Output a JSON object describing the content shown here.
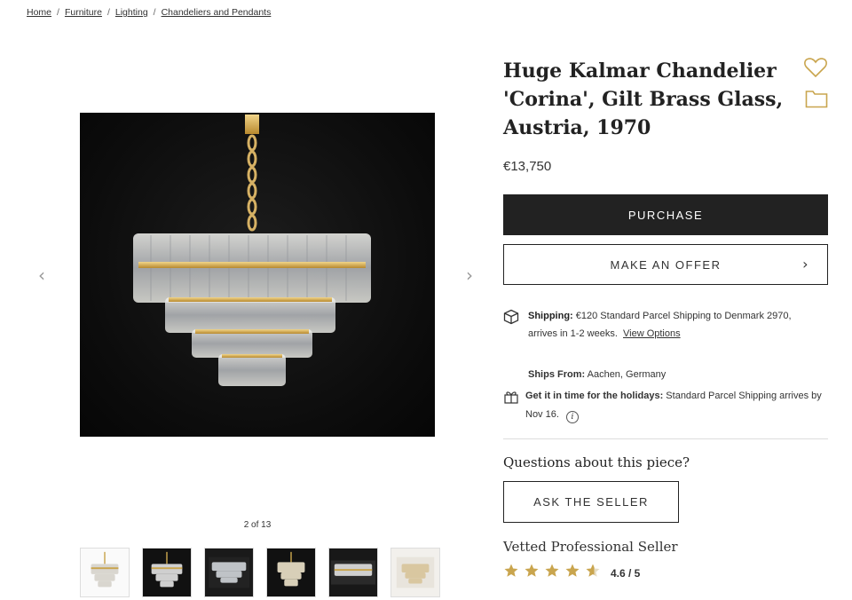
{
  "breadcrumb": [
    "Home",
    "Furniture",
    "Lighting",
    "Chandeliers and Pendants"
  ],
  "breadcrumb_sep": "/",
  "gallery": {
    "counter": "2 of 13",
    "prev_icon": "chevron-left-icon",
    "next_icon": "chevron-right-icon",
    "prev_glyph": "‹",
    "next_glyph": "›",
    "thumbnail_count": 6
  },
  "product": {
    "title": "Huge Kalmar Chandelier 'Corina', Gilt Brass Glass, Austria, 1970",
    "price": "€13,750"
  },
  "actions": {
    "purchase": "PURCHASE",
    "offer": "MAKE AN OFFER",
    "offer_chevron": "›"
  },
  "shipping": {
    "label": "Shipping:",
    "text": " €120 Standard Parcel Shipping to Denmark 2970, arrives in 1-2 weeks.",
    "link": "View Options",
    "ships_from_label": "Ships From:",
    "ships_from": " Aachen, Germany",
    "holiday_label": "Get it in time for the holidays:",
    "holiday_text": " Standard Parcel Shipping arrives by Nov 16.",
    "info_glyph": "i"
  },
  "seller": {
    "questions": "Questions about this piece?",
    "ask": "ASK THE SELLER",
    "vetted": "Vetted Professional Seller",
    "rating": "4.6 / 5",
    "rating_value": 4.6,
    "rating_max": 5
  },
  "colors": {
    "accent_gold": "#c9a54e",
    "dark": "#222222",
    "image_bg": "#0c0c0c"
  }
}
